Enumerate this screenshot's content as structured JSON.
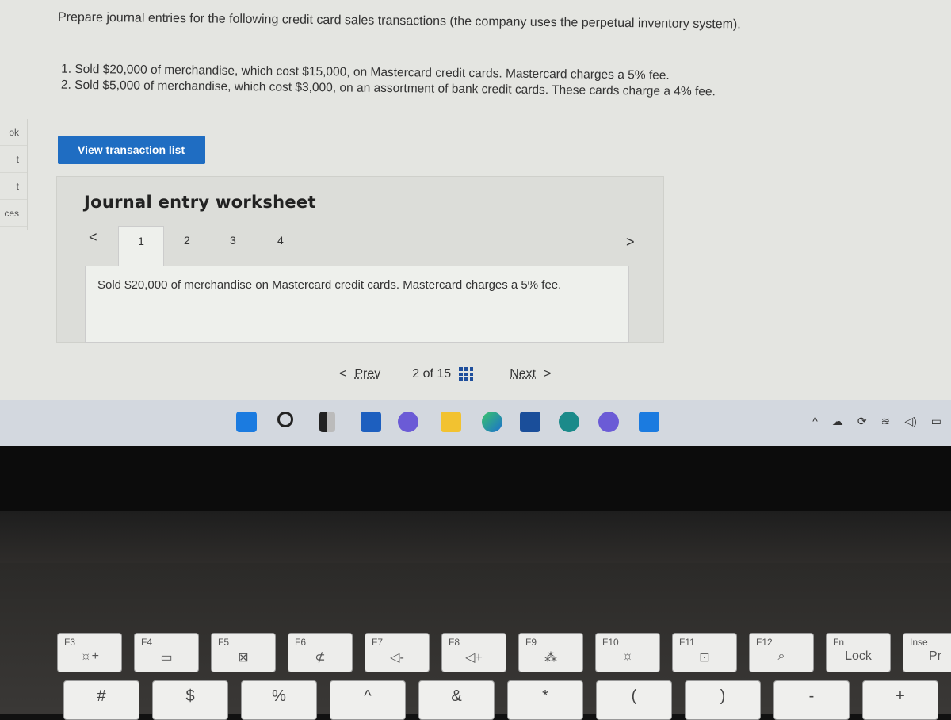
{
  "sidebar": {
    "items": [
      "ok",
      "t",
      "t",
      "ces"
    ]
  },
  "prompt": "Prepare journal entries for the following credit card sales transactions (the company uses the perpetual inventory system).",
  "transactions": [
    "1. Sold $20,000 of merchandise, which cost $15,000, on Mastercard credit cards. Mastercard charges a 5% fee.",
    "2. Sold $5,000 of merchandise, which cost $3,000, on an assortment of bank credit cards. These cards charge a 4% fee."
  ],
  "view_button": "View transaction list",
  "worksheet": {
    "title": "Journal entry worksheet",
    "tabs": [
      "1",
      "2",
      "3",
      "4"
    ],
    "active_tab": "1",
    "prev_arrow": "<",
    "next_arrow": ">",
    "description": "Sold $20,000 of merchandise on Mastercard credit cards. Mastercard charges a 5% fee."
  },
  "pager": {
    "prev": "Prev",
    "position": "2 of 15",
    "next": "Next"
  },
  "taskbar": {
    "icons": [
      "windows-start",
      "search",
      "task-view",
      "widgets",
      "teams-chat",
      "file-explorer",
      "edge",
      "microsoft-store",
      "search-app",
      "app",
      "cortana"
    ],
    "tray": [
      "^",
      "☁",
      "⟳",
      "wifi",
      "volume",
      "battery"
    ]
  },
  "keyboard": {
    "fkeys": [
      {
        "label": "F3",
        "glyph": "☼+"
      },
      {
        "label": "F4",
        "glyph": "▭"
      },
      {
        "label": "F5",
        "glyph": "⊠"
      },
      {
        "label": "F6",
        "glyph": "⊄"
      },
      {
        "label": "F7",
        "glyph": "◁-"
      },
      {
        "label": "F8",
        "glyph": "◁+"
      },
      {
        "label": "F9",
        "glyph": "⁂"
      },
      {
        "label": "F10",
        "glyph": "☼"
      },
      {
        "label": "F11",
        "glyph": "⊡"
      },
      {
        "label": "F12",
        "glyph": "⌕"
      },
      {
        "label": "Fn",
        "glyph": "Lock"
      },
      {
        "label": "Inse",
        "glyph": "Pr"
      }
    ],
    "numkeys": [
      "#",
      "$",
      "%",
      "^",
      "&",
      "*",
      "(",
      ")",
      "-",
      "+"
    ]
  }
}
